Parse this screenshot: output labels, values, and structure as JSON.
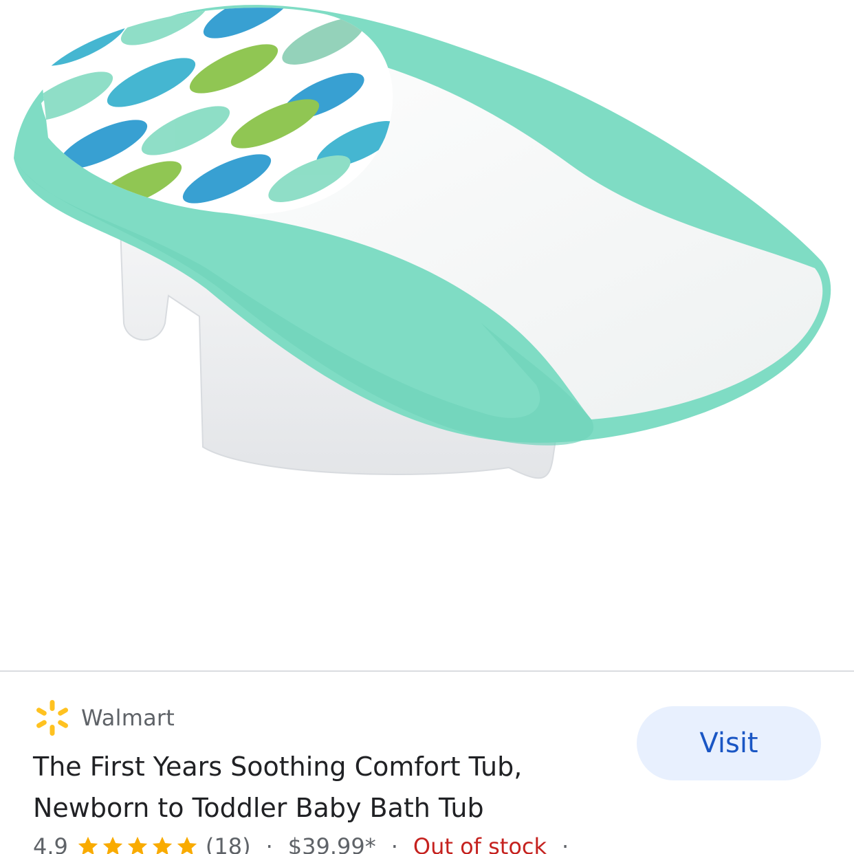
{
  "product": {
    "image_alt": "Baby bath tub with mint green sling and leaf pattern",
    "title": "The First Years Soothing Comfort Tub, Newborn to Toddler Baby Bath Tub",
    "merchant": {
      "name": "Walmart",
      "logo_icon": "walmart-spark-icon",
      "logo_color": "#ffc220"
    },
    "visit_label": "Visit",
    "rating": {
      "value": "4.9",
      "stars": 5,
      "count": "(18)"
    },
    "price": "$39.99*",
    "availability": "Out of stock",
    "separator": "·"
  },
  "colors": {
    "accent_blue": "#1a56c4",
    "visit_bg": "#e8f0fe",
    "star": "#f9ab00",
    "out_of_stock": "#c5221f",
    "mint": "#7fdcc4"
  }
}
